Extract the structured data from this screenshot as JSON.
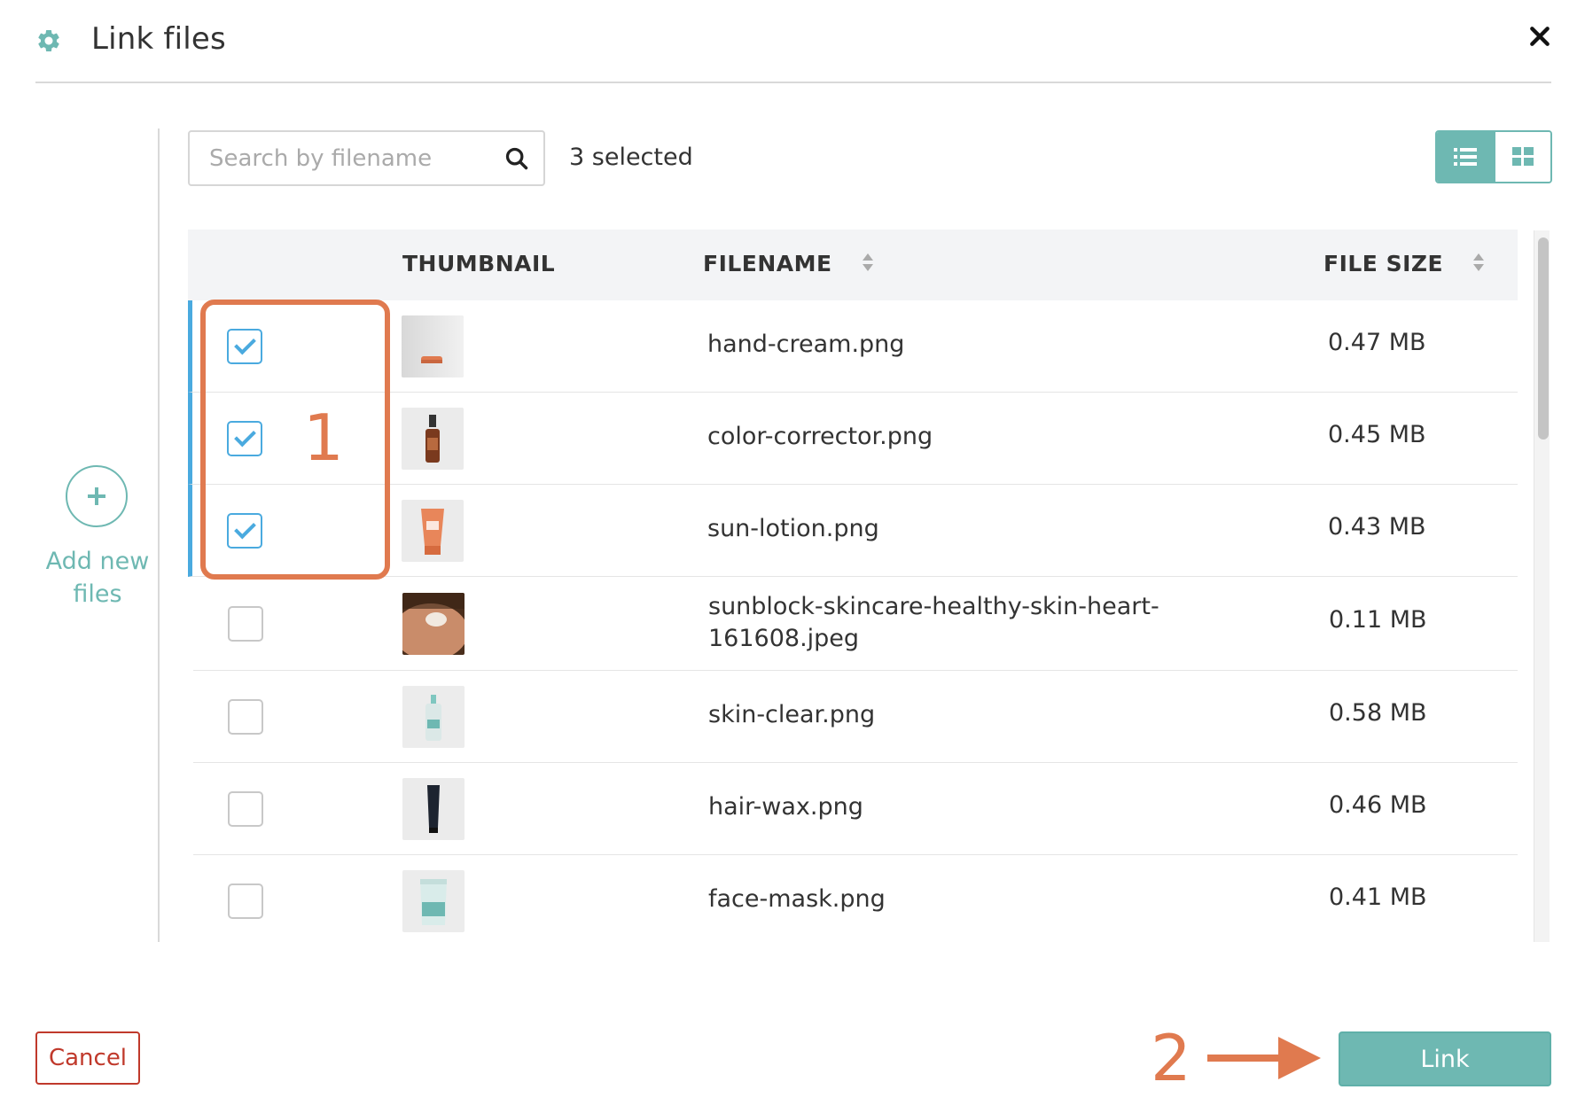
{
  "dialog": {
    "title": "Link files",
    "icon": "gear-icon",
    "close_icon": "close-icon"
  },
  "sidebar": {
    "add_label": "Add new files",
    "add_icon": "plus-icon"
  },
  "toolbar": {
    "search_placeholder": "Search by filename",
    "search_value": "",
    "selected_text": "3 selected",
    "view_modes": [
      {
        "name": "list-view",
        "icon": "list-icon",
        "active": true
      },
      {
        "name": "grid-view",
        "icon": "grid-icon",
        "active": false
      }
    ]
  },
  "table": {
    "headers": {
      "thumbnail": "THUMBNAIL",
      "filename": "FILENAME",
      "filesize": "FILE SIZE"
    },
    "rows": [
      {
        "filename": "hand-cream.png",
        "size": "0.47 MB",
        "checked": true,
        "thumb": "hand-cream"
      },
      {
        "filename": "color-corrector.png",
        "size": "0.45 MB",
        "checked": true,
        "thumb": "dropper-bottle"
      },
      {
        "filename": "sun-lotion.png",
        "size": "0.43 MB",
        "checked": true,
        "thumb": "lotion-tube"
      },
      {
        "filename": "sunblock-skincare-healthy-skin-heart-161608.jpeg",
        "filename_line1": "sunblock-skincare-healthy-skin-heart-",
        "filename_line2": "161608.jpeg",
        "size": "0.11 MB",
        "checked": false,
        "thumb": "skin-heart"
      },
      {
        "filename": "skin-clear.png",
        "size": "0.58 MB",
        "checked": false,
        "thumb": "pump-bottle"
      },
      {
        "filename": "hair-wax.png",
        "size": "0.46 MB",
        "checked": false,
        "thumb": "black-tube"
      },
      {
        "filename": "face-mask.png",
        "size": "0.41 MB",
        "checked": false,
        "thumb": "mask-pouch"
      }
    ]
  },
  "annotations": {
    "step1": "1",
    "step2": "2"
  },
  "footer": {
    "cancel_label": "Cancel",
    "link_label": "Link"
  },
  "colors": {
    "accent": "#6eb8b2",
    "checkbox_blue": "#4aaadf",
    "annotation_orange": "#e07a4f",
    "cancel_red": "#c0392b"
  }
}
